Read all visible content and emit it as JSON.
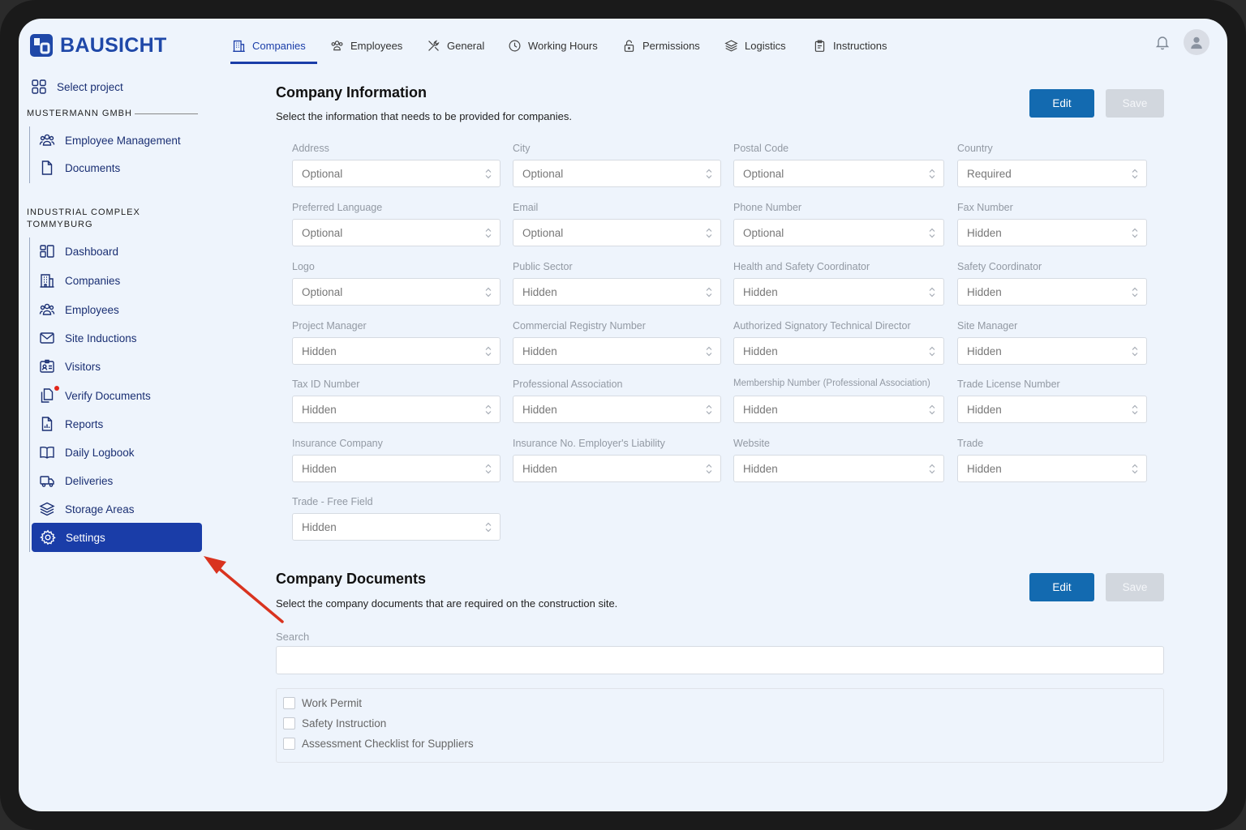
{
  "app": {
    "name": "BAUSICHT"
  },
  "sidebar": {
    "select_project": "Select project",
    "group1_label": "MUSTERMANN GMBH",
    "group1_items": [
      {
        "label": "Employee Management",
        "icon": "users-icon"
      },
      {
        "label": "Documents",
        "icon": "document-icon"
      }
    ],
    "group2_label_line1": "INDUSTRIAL COMPLEX",
    "group2_label_line2": "TOMMYBURG",
    "group2_items": [
      {
        "label": "Dashboard",
        "icon": "dashboard-icon"
      },
      {
        "label": "Companies",
        "icon": "building-icon"
      },
      {
        "label": "Employees",
        "icon": "users-icon"
      },
      {
        "label": "Site Inductions",
        "icon": "envelope-icon"
      },
      {
        "label": "Visitors",
        "icon": "visitor-badge-icon"
      },
      {
        "label": "Verify Documents",
        "icon": "documents-icon",
        "notification_dot": true
      },
      {
        "label": "Reports",
        "icon": "report-icon"
      },
      {
        "label": "Daily Logbook",
        "icon": "book-icon"
      },
      {
        "label": "Deliveries",
        "icon": "truck-icon"
      },
      {
        "label": "Storage Areas",
        "icon": "layers-icon"
      },
      {
        "label": "Settings",
        "icon": "gear-icon",
        "active": true
      }
    ]
  },
  "tabs": [
    {
      "label": "Companies",
      "icon": "building-icon",
      "active": true
    },
    {
      "label": "Employees",
      "icon": "users-icon"
    },
    {
      "label": "General",
      "icon": "tools-icon"
    },
    {
      "label": "Working Hours",
      "icon": "clock-icon"
    },
    {
      "label": "Permissions",
      "icon": "lock-icon"
    },
    {
      "label": "Logistics",
      "icon": "layers-icon"
    },
    {
      "label": "Instructions",
      "icon": "clipboard-icon"
    }
  ],
  "company_info": {
    "title": "Company Information",
    "description": "Select the information that needs to be provided for companies.",
    "edit_label": "Edit",
    "save_label": "Save",
    "fields": [
      {
        "label": "Address",
        "value": "Optional"
      },
      {
        "label": "City",
        "value": "Optional"
      },
      {
        "label": "Postal Code",
        "value": "Optional"
      },
      {
        "label": "Country",
        "value": "Required"
      },
      {
        "label": "Preferred Language",
        "value": "Optional"
      },
      {
        "label": "Email",
        "value": "Optional"
      },
      {
        "label": "Phone Number",
        "value": "Optional"
      },
      {
        "label": "Fax Number",
        "value": "Hidden"
      },
      {
        "label": "Logo",
        "value": "Optional"
      },
      {
        "label": "Public Sector",
        "value": "Hidden"
      },
      {
        "label": "Health and Safety Coordinator",
        "value": "Hidden"
      },
      {
        "label": "Safety Coordinator",
        "value": "Hidden"
      },
      {
        "label": "Project Manager",
        "value": "Hidden"
      },
      {
        "label": "Commercial Registry Number",
        "value": "Hidden"
      },
      {
        "label": "Authorized Signatory Technical Director",
        "value": "Hidden"
      },
      {
        "label": "Site Manager",
        "value": "Hidden"
      },
      {
        "label": "Tax ID Number",
        "value": "Hidden"
      },
      {
        "label": "Professional Association",
        "value": "Hidden"
      },
      {
        "label": "Membership Number (Professional Association)",
        "value": "Hidden"
      },
      {
        "label": "Trade License Number",
        "value": "Hidden"
      },
      {
        "label": "Insurance Company",
        "value": "Hidden"
      },
      {
        "label": "Insurance No. Employer's Liability",
        "value": "Hidden"
      },
      {
        "label": "Website",
        "value": "Hidden"
      },
      {
        "label": "Trade",
        "value": "Hidden"
      },
      {
        "label": "Trade - Free Field",
        "value": "Hidden"
      }
    ]
  },
  "company_docs": {
    "title": "Company Documents",
    "description": "Select the company documents that are required on the construction site.",
    "edit_label": "Edit",
    "save_label": "Save",
    "search_label": "Search",
    "search_value": "",
    "documents": [
      "Work Permit",
      "Safety Instruction",
      "Assessment Checklist for Suppliers"
    ]
  },
  "colors": {
    "brand": "#1f48a8",
    "active_nav": "#1a3da8",
    "edit_button": "#136ab0",
    "annotation_arrow": "#d9331f",
    "notification": "#e2261b"
  }
}
